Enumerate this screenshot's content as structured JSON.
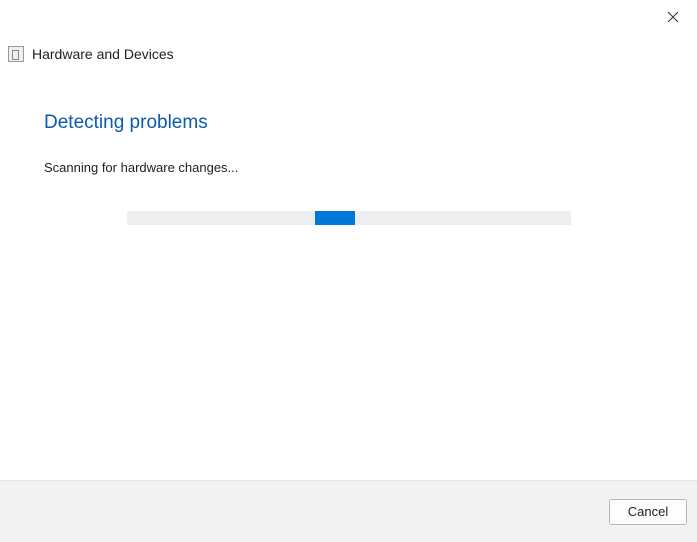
{
  "window": {
    "title": "Hardware and Devices"
  },
  "main": {
    "heading": "Detecting problems",
    "status": "Scanning for hardware changes..."
  },
  "footer": {
    "cancel_label": "Cancel"
  }
}
